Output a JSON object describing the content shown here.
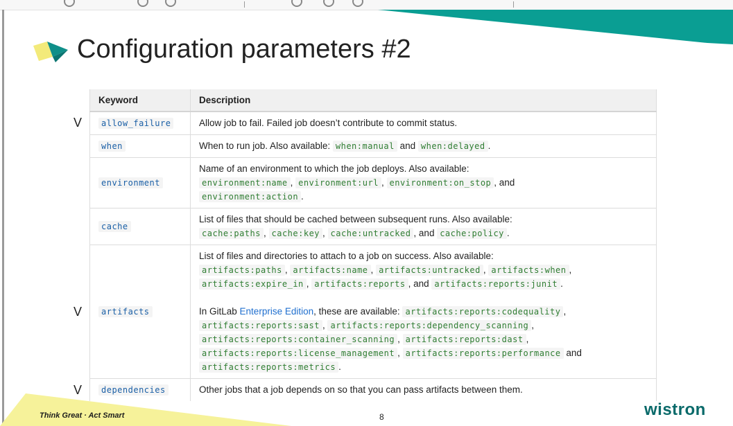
{
  "slide": {
    "title": "Configuration parameters #2",
    "page_number": "8",
    "slogan": "Think Great · Act Smart",
    "logo": "wistron"
  },
  "colors": {
    "teal": "#0a9e93",
    "yellow": "#f6f29a",
    "code_green": "#2f7d32",
    "keyword_blue": "#1a5fa6"
  },
  "table": {
    "headers": [
      "Keyword",
      "Description"
    ],
    "rows": [
      {
        "keyword": "allow_failure",
        "check": "V",
        "parts": [
          {
            "t": "Allow job to fail. Failed job doesn’t contribute to commit status."
          }
        ]
      },
      {
        "keyword": "when",
        "check": "",
        "parts": [
          {
            "t": "When to run job. Also available: "
          },
          {
            "c": "when:manual"
          },
          {
            "t": " and "
          },
          {
            "c": "when:delayed"
          },
          {
            "t": "."
          }
        ]
      },
      {
        "keyword": "environment",
        "check": "",
        "parts": [
          {
            "t": "Name of an environment to which the job deploys. Also available: "
          },
          {
            "br": true
          },
          {
            "c": "environment:name"
          },
          {
            "t": ", "
          },
          {
            "c": "environment:url"
          },
          {
            "t": ", "
          },
          {
            "c": "environment:on_stop"
          },
          {
            "t": ", and "
          },
          {
            "br": true
          },
          {
            "c": "environment:action"
          },
          {
            "t": "."
          }
        ]
      },
      {
        "keyword": "cache",
        "check": "",
        "parts": [
          {
            "t": "List of files that should be cached between subsequent runs. Also available: "
          },
          {
            "br": true
          },
          {
            "c": "cache:paths"
          },
          {
            "t": ", "
          },
          {
            "c": "cache:key"
          },
          {
            "t": ", "
          },
          {
            "c": "cache:untracked"
          },
          {
            "t": ", and "
          },
          {
            "c": "cache:policy"
          },
          {
            "t": "."
          }
        ]
      },
      {
        "keyword": "artifacts",
        "check": "V",
        "parts": [
          {
            "t": "List of files and directories to attach to a job on success. Also available: "
          },
          {
            "br": true
          },
          {
            "c": "artifacts:paths"
          },
          {
            "t": ", "
          },
          {
            "c": "artifacts:name"
          },
          {
            "t": ", "
          },
          {
            "c": "artifacts:untracked"
          },
          {
            "t": ", "
          },
          {
            "c": "artifacts:when"
          },
          {
            "t": ","
          },
          {
            "br": true
          },
          {
            "c": "artifacts:expire_in"
          },
          {
            "t": ", "
          },
          {
            "c": "artifacts:reports"
          },
          {
            "t": ", and "
          },
          {
            "c": "artifacts:reports:junit"
          },
          {
            "t": "."
          },
          {
            "br": true
          },
          {
            "br": true
          },
          {
            "t": "In GitLab "
          },
          {
            "l": "Enterprise Edition"
          },
          {
            "t": ", these are available: "
          },
          {
            "c": "artifacts:reports:codequality"
          },
          {
            "t": ","
          },
          {
            "br": true
          },
          {
            "c": "artifacts:reports:sast"
          },
          {
            "t": ", "
          },
          {
            "c": "artifacts:reports:dependency_scanning"
          },
          {
            "t": ","
          },
          {
            "br": true
          },
          {
            "c": "artifacts:reports:container_scanning"
          },
          {
            "t": ", "
          },
          {
            "c": "artifacts:reports:dast"
          },
          {
            "t": ","
          },
          {
            "br": true
          },
          {
            "c": "artifacts:reports:license_management"
          },
          {
            "t": ", "
          },
          {
            "c": "artifacts:reports:performance"
          },
          {
            "t": " and"
          },
          {
            "br": true
          },
          {
            "c": "artifacts:reports:metrics"
          },
          {
            "t": "."
          }
        ]
      },
      {
        "keyword": "dependencies",
        "check": "V",
        "parts": [
          {
            "t": "Other jobs that a job depends on so that you can pass artifacts between them."
          }
        ]
      }
    ]
  }
}
